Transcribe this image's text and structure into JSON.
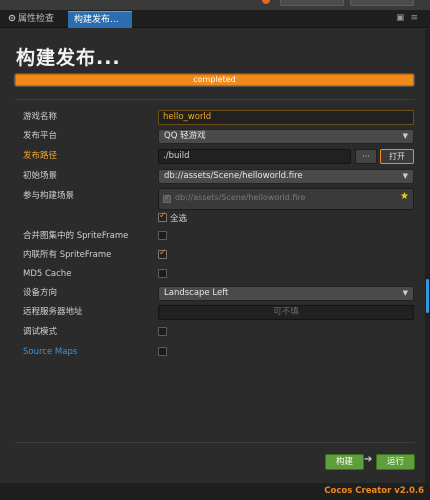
{
  "tabs": [
    {
      "label": "属性检查器"
    },
    {
      "label": "构建发布..."
    }
  ],
  "header": {
    "title": "构建发布..."
  },
  "progress": {
    "status_text": "completed",
    "value": 1.0
  },
  "form": {
    "game_name_label": "游戏名称",
    "game_name_value": "hello_world",
    "platform_label": "发布平台",
    "platform_value": "QQ 轻游戏",
    "publish_path_label": "发布路径",
    "publish_path_value": "./build",
    "dots_button": "···",
    "open_button": "打开",
    "start_scene_label": "初始场景",
    "start_scene_value": "db://assets/Scene/helloworld.fire",
    "build_scenes_label": "参与构建场景",
    "build_scene_item": "db://assets/Scene/helloworld.fire",
    "select_all_label": "全选",
    "merge_spriteframe_label": "合并图集中的 SpriteFrame",
    "inline_spriteframe_label": "内联所有 SpriteFrame",
    "md5_label": "MD5 Cache",
    "orientation_label": "设备方向",
    "orientation_value": "Landscape Left",
    "remote_server_label": "远程服务器地址",
    "remote_server_placeholder": "可不填",
    "debug_label": "调试模式",
    "source_maps_label": "Source Maps"
  },
  "checkboxes": {
    "select_all": true,
    "merge_spriteframe": false,
    "inline_spriteframe": true,
    "md5_cache": false,
    "debug": false,
    "source_maps": false
  },
  "actions": {
    "build_label": "构建",
    "run_label": "运行"
  },
  "footer": {
    "version": "Cocos Creator v2.0.6"
  },
  "colors": {
    "accent_orange": "#f08a1b",
    "tab_blue": "#2c6db0",
    "action_green": "#5f9f3b",
    "link_blue": "#3a96dd"
  }
}
